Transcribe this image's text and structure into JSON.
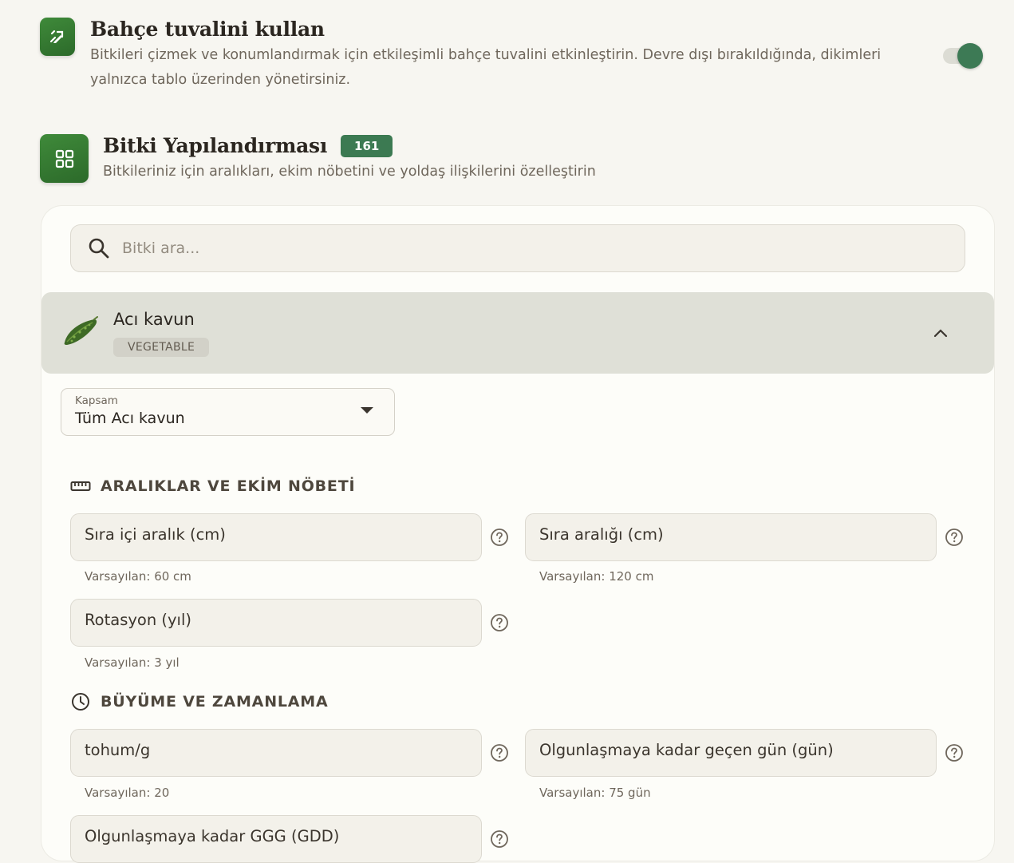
{
  "setting": {
    "title": "Bahçe tuvalini kullan",
    "description": "Bitkileri çizmek ve konumlandırmak için etkileşimli bahçe tuvalini etkinleştirin. Devre dışı bırakıldığında, dikimleri yalnızca tablo üzerinden yönetirsiniz.",
    "enabled": true,
    "icon": "pencil-edit-icon"
  },
  "section": {
    "title": "Bitki Yapılandırması",
    "count": "161",
    "description": "Bitkileriniz için aralıkları, ekim nöbetini ve yoldaş ilişkilerini özelleştirin",
    "icon": "grid-icon"
  },
  "search": {
    "placeholder": "Bitki ara..."
  },
  "plant": {
    "name": "Acı kavun",
    "category": "VEGETABLE",
    "expanded": true
  },
  "scope": {
    "label": "Kapsam",
    "value": "Tüm Acı kavun"
  },
  "spacing": {
    "heading": "ARALIKLAR VE EKİM NÖBETİ",
    "in_row_label": "Sıra içi aralık (cm)",
    "in_row_hint": "Varsayılan: 60 cm",
    "row_label": "Sıra aralığı (cm)",
    "row_hint": "Varsayılan: 120 cm",
    "rotation_label": "Rotasyon (yıl)",
    "rotation_hint": "Varsayılan: 3 yıl"
  },
  "growth": {
    "heading": "BÜYÜME VE ZAMANLAMA",
    "seeds_label": "tohum/g",
    "seeds_hint": "Varsayılan: 20",
    "maturity_label": "Olgunlaşmaya kadar geçen gün (gün)",
    "maturity_hint": "Varsayılan: 75 gün",
    "gdd_label": "Olgunlaşmaya kadar GGG (GDD)"
  },
  "colors": {
    "accent": "#3c7a52",
    "icon_green": "#3f8a3a",
    "background": "#f7f6f1"
  }
}
